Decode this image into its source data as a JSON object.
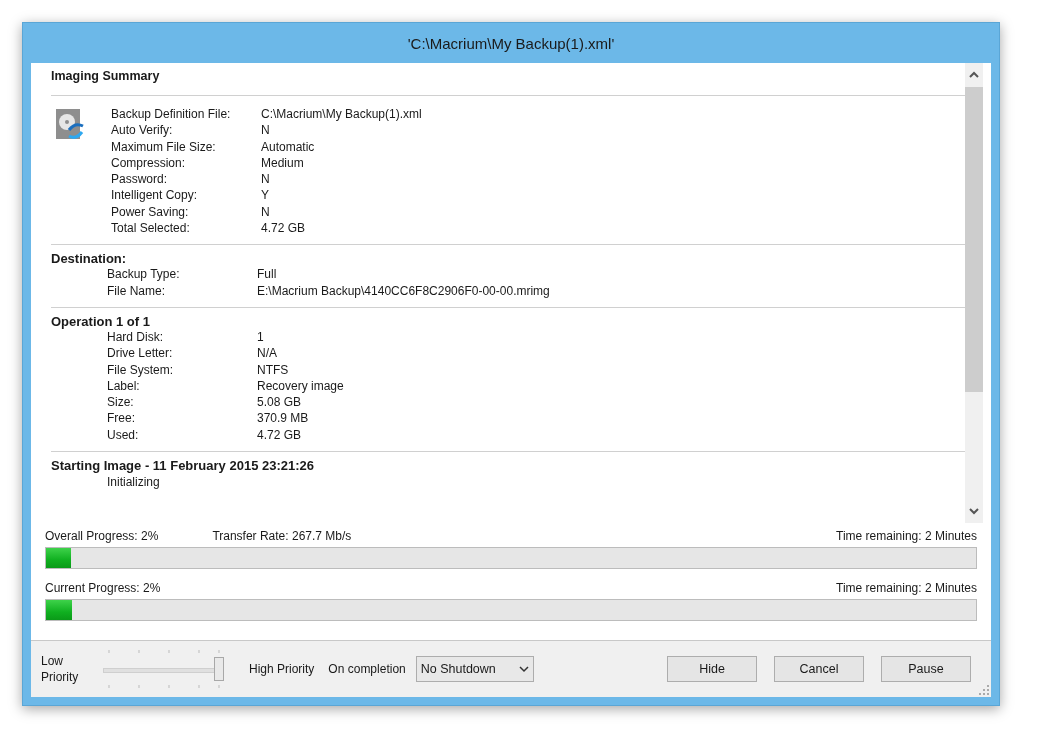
{
  "window": {
    "title": "'C:\\Macrium\\My Backup(1).xml'"
  },
  "sections": [
    {
      "title": "Imaging Summary",
      "kind": "summary",
      "rows": [
        {
          "label": "Backup Definition File:",
          "value": "C:\\Macrium\\My Backup(1).xml"
        },
        {
          "label": "Auto Verify:",
          "value": "N"
        },
        {
          "label": "Maximum File Size:",
          "value": "Automatic"
        },
        {
          "label": "Compression:",
          "value": "Medium"
        },
        {
          "label": "Password:",
          "value": "N"
        },
        {
          "label": "Intelligent Copy:",
          "value": "Y"
        },
        {
          "label": "Power Saving:",
          "value": "N"
        },
        {
          "label": "Total Selected:",
          "value": "4.72 GB"
        }
      ]
    },
    {
      "title": "Destination:",
      "kind": "plain",
      "rows": [
        {
          "label": "Backup Type:",
          "value": "Full"
        },
        {
          "label": "File Name:",
          "value": "E:\\Macrium Backup\\4140CC6F8C2906F0-00-00.mrimg"
        }
      ]
    },
    {
      "title": "Operation 1 of 1",
      "kind": "plain",
      "rows": [
        {
          "label": "Hard Disk:",
          "value": "1"
        },
        {
          "label": "Drive Letter:",
          "value": "N/A"
        },
        {
          "label": "File System:",
          "value": "NTFS"
        },
        {
          "label": "Label:",
          "value": "Recovery image"
        },
        {
          "label": "Size:",
          "value": "5.08 GB"
        },
        {
          "label": "Free:",
          "value": "370.9 MB"
        },
        {
          "label": "Used:",
          "value": "4.72 GB"
        }
      ]
    },
    {
      "title": "Starting Image - 11 February 2015 23:21:26",
      "kind": "status",
      "status": "Initializing"
    }
  ],
  "progress": [
    {
      "label": "Overall Progress:  2%",
      "transfer_rate": "Transfer Rate: 267.7 Mb/s",
      "time_remaining": "Time remaining: 2 Minutes",
      "level": 0.027
    },
    {
      "label": "Current Progress:  2%",
      "time_remaining": "Time remaining: 2 Minutes",
      "level": 0.028
    }
  ],
  "footer": {
    "priority_low": "Low Priority",
    "priority_high": "High Priority",
    "priority": {
      "level": 1
    },
    "on_completion_label": "On completion",
    "on_completion": "No Shutdown",
    "buttons": [
      "Hide",
      "Cancel",
      "Pause"
    ]
  }
}
